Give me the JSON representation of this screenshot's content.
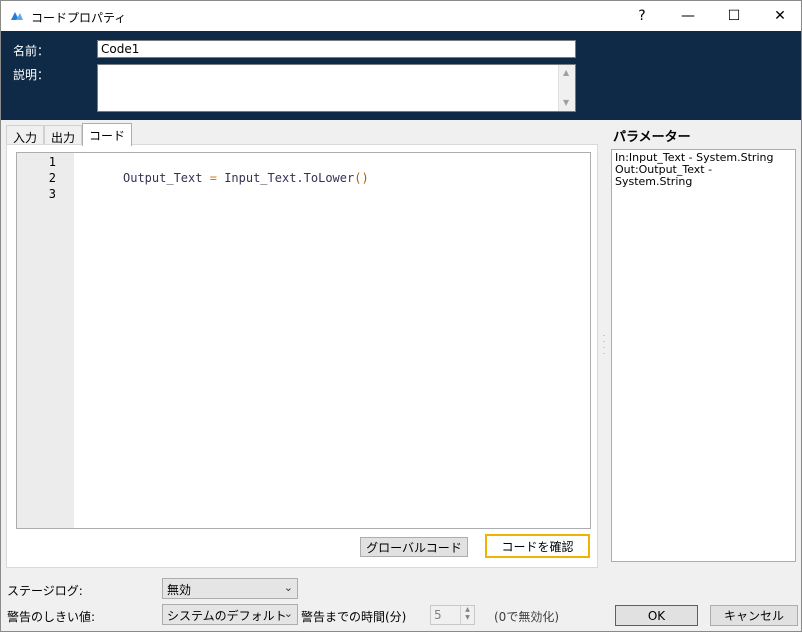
{
  "window": {
    "title": "コードプロパティ",
    "help_label": "?",
    "minimize_label": "—",
    "maximize_label": "☐",
    "close_label": "✕"
  },
  "header": {
    "name_label": "名前：",
    "name_value": "Code1",
    "description_label": "説明：",
    "description_value": ""
  },
  "tabs": [
    {
      "label": "入力"
    },
    {
      "label": "出力"
    },
    {
      "label": "コード"
    }
  ],
  "editor": {
    "line_numbers": [
      "1",
      "2",
      "3"
    ],
    "code": {
      "lhs": "Output_Text",
      "op": "=",
      "rhs": "Input_Text.ToLower",
      "parens": "()"
    }
  },
  "buttons": {
    "global_code": "グローバルコード",
    "check_code": "コードを確認",
    "ok": "OK",
    "cancel": "キャンセル"
  },
  "parameters": {
    "title": "パラメーター",
    "items": [
      "In:Input_Text - System.String",
      "Out:Output_Text - System.String"
    ]
  },
  "bottom": {
    "stage_log_label": "ステージログ:",
    "stage_log_value": "無効",
    "warning_threshold_label": "警告のしきい値:",
    "warning_threshold_value": "システムのデフォルト",
    "time_label": "警告までの時間(分)",
    "time_value": "5",
    "time_hint": "(0で無効化)"
  },
  "colors": {
    "header_bg": "#0f2a47",
    "focus_border": "#f0b400",
    "operator": "#e07b00"
  }
}
